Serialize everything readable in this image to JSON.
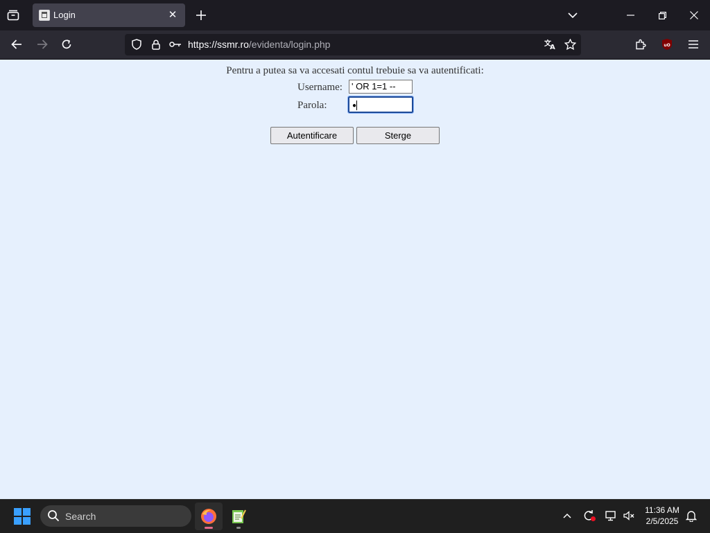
{
  "browser": {
    "tab_title": "Login",
    "url_domain": "https://ssmr.ro",
    "url_path": "/evidenta/login.php"
  },
  "page": {
    "intro": "Pentru a putea sa va accesati contul trebuie sa va autentificati:",
    "username_label": "Username:",
    "username_value": "' OR 1=1 --",
    "password_label": "Parola:",
    "password_value": "●",
    "submit_label": "Autentificare",
    "clear_label": "Sterge"
  },
  "taskbar": {
    "search_placeholder": "Search",
    "time": "11:36 AM",
    "date": "2/5/2025"
  },
  "colors": {
    "page_bg": "#e6f0fd",
    "browser_chrome": "#2b2a33",
    "tab_active": "#42414d",
    "focus_ring": "#1e4a96",
    "windows_accent": "#3aa0ff"
  }
}
